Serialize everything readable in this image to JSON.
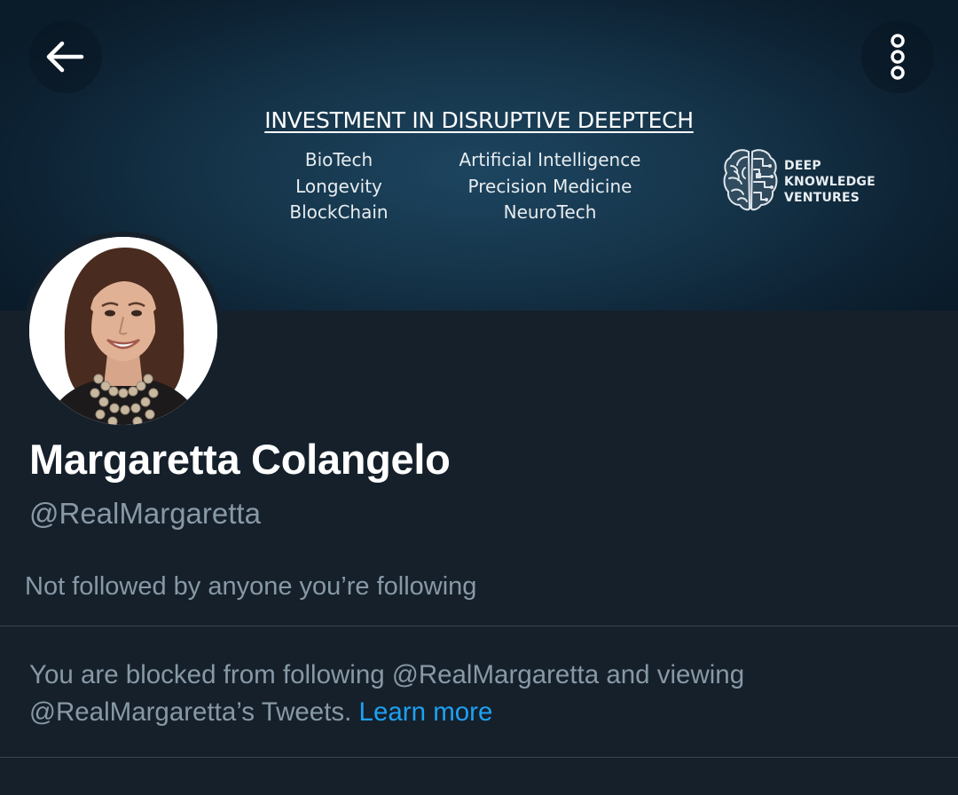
{
  "banner": {
    "heading": "INVESTMENT IN DISRUPTIVE DEEPTECH",
    "left_items": [
      "BioTech",
      "Longevity",
      "BlockChain"
    ],
    "right_items": [
      "Artificial Intelligence",
      "Precision Medicine",
      "NeuroTech"
    ],
    "brand_lines": [
      "DEEP",
      "KNOWLEDGE",
      "VENTURES"
    ]
  },
  "header": {
    "back_icon": "arrow-left-icon",
    "more_icon": "more-vertical-icon"
  },
  "profile": {
    "name": "Margaretta Colangelo",
    "handle": "@RealMargaretta",
    "followed_by": "Not followed by anyone you’re following"
  },
  "blocked_notice": {
    "text": "You are blocked from following @RealMargaretta and viewing @RealMargaretta’s Tweets. ",
    "link_label": "Learn more"
  },
  "colors": {
    "background": "#15202b",
    "secondary_text": "#8899a6",
    "link": "#1da1f2",
    "divider": "#38444d"
  }
}
